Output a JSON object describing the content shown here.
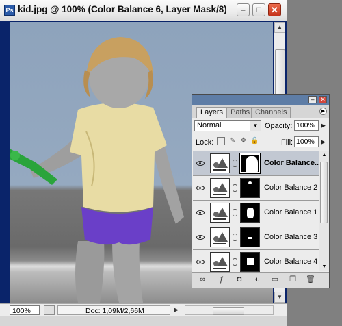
{
  "document": {
    "title": "kid.jpg @ 100% (Color Balance 6, Layer Mask/8)",
    "zoom": "100%",
    "doc_info": "Doc: 1,09M/2,66M"
  },
  "palette": {
    "tabs": [
      "Layers",
      "Paths",
      "Channels"
    ],
    "active_tab": "Layers",
    "blend_mode": "Normal",
    "opacity_label": "Opacity:",
    "opacity_value": "100%",
    "lock_label": "Lock:",
    "fill_label": "Fill:",
    "fill_value": "100%",
    "layers": [
      {
        "name": "Color Balance...",
        "selected": true
      },
      {
        "name": "Color Balance 2",
        "selected": false
      },
      {
        "name": "Color Balance 1",
        "selected": false
      },
      {
        "name": "Color Balance 3",
        "selected": false
      },
      {
        "name": "Color Balance 4",
        "selected": false
      }
    ]
  },
  "icons": {
    "eye": "eye-icon",
    "chain": "link-icon",
    "menu": "palette-menu-icon"
  },
  "colors": {
    "active_title_close": "#d24e2f",
    "selected_layer": "#c2c8d2",
    "shorts": "#6a3fc8",
    "toy": "#2aa43c",
    "shirt": "#e8dca4"
  }
}
